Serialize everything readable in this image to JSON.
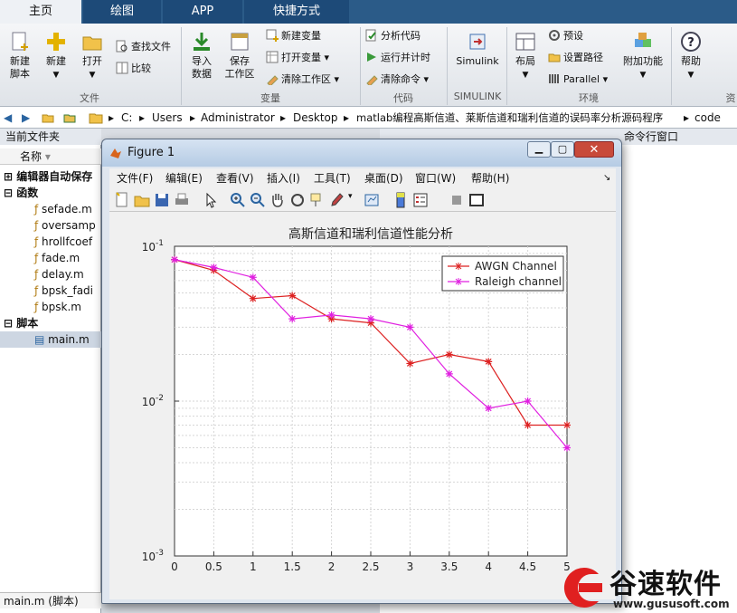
{
  "tabs": [
    "主页",
    "绘图",
    "APP",
    "快捷方式"
  ],
  "ribbon": {
    "new_script": "新建\n脚本",
    "new": "新建",
    "open": "打开",
    "find_files": "查找文件",
    "compare": "比较",
    "import": "导入\n数据",
    "save_ws": "保存\n工作区",
    "new_var": "新建变量",
    "open_var": "打开变量",
    "clear_ws": "清除工作区",
    "analyze": "分析代码",
    "run_time": "运行并计时",
    "clear_cmd": "清除命令",
    "simulink": "Simulink",
    "layout": "布局",
    "prefs": "预设",
    "set_path": "设置路径",
    "parallel": "Parallel",
    "addons": "附加功能",
    "help": "帮助",
    "groups": [
      "文件",
      "变量",
      "代码",
      "SIMULINK",
      "环境",
      "资"
    ]
  },
  "address": {
    "path": [
      "C:",
      "Users",
      "Administrator",
      "Desktop",
      "matlab编程高斯信道、莱斯信道和瑞利信道的误码率分析源码程序",
      "code"
    ]
  },
  "current_folder": {
    "title": "当前文件夹",
    "column": "名称",
    "sections": [
      {
        "label": "编辑器自动保存",
        "items": []
      },
      {
        "label": "函数",
        "items": [
          "sefade.m",
          "oversamp",
          "hrollfcoef",
          "fade.m",
          "delay.m",
          "bpsk_fadi",
          "bpsk.m"
        ]
      },
      {
        "label": "脚本",
        "items": [
          "main.m"
        ]
      }
    ],
    "status": "main.m  (脚本)"
  },
  "cmd_title": "命令行窗口",
  "figure": {
    "title": "Figure 1",
    "menu": [
      "文件(F)",
      "编辑(E)",
      "查看(V)",
      "插入(I)",
      "工具(T)",
      "桌面(D)",
      "窗口(W)",
      "帮助(H)"
    ]
  },
  "chart_data": {
    "type": "line",
    "title": "高斯信道和瑞利信道性能分析",
    "xlabel": "",
    "ylabel": "",
    "x": [
      0,
      0.5,
      1,
      1.5,
      2,
      2.5,
      3,
      3.5,
      4,
      4.5,
      5
    ],
    "xlim": [
      0,
      5
    ],
    "ylim": [
      0.001,
      0.1
    ],
    "yscale": "log",
    "xticks": [
      "0",
      "0.5",
      "1",
      "1.5",
      "2",
      "2.5",
      "3",
      "3.5",
      "4",
      "4.5",
      "5"
    ],
    "yticks": [
      {
        "base": "10",
        "exp": "-1"
      },
      {
        "base": "10",
        "exp": "-2"
      },
      {
        "base": "10",
        "exp": "-3"
      }
    ],
    "grid": true,
    "legend_position": "top-right",
    "series": [
      {
        "name": "AWGN Channel",
        "color": "#dd2222",
        "marker": "asterisk",
        "values": [
          0.082,
          0.07,
          0.046,
          0.048,
          0.034,
          0.032,
          0.0175,
          0.02,
          0.018,
          0.007,
          0.007
        ]
      },
      {
        "name": "Raleigh channel",
        "color": "#e020e0",
        "marker": "asterisk",
        "values": [
          0.082,
          0.073,
          0.063,
          0.034,
          0.036,
          0.034,
          0.03,
          0.015,
          0.009,
          0.01,
          0.005
        ]
      }
    ]
  },
  "watermark": {
    "brand": "谷速软件",
    "url": "www.gususoft.com"
  }
}
